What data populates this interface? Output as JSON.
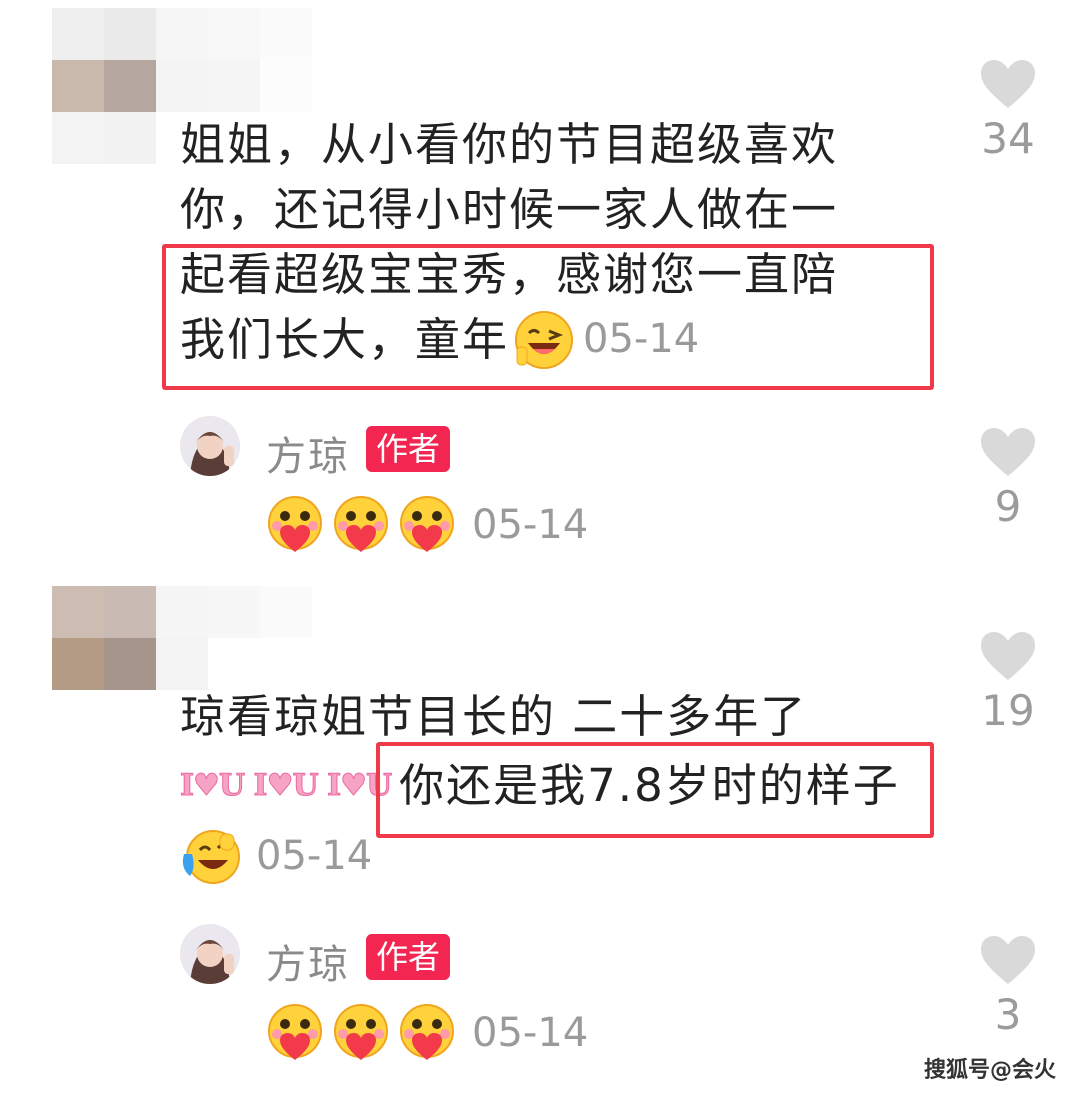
{
  "comments": [
    {
      "lines": [
        "姐姐，从小看你的节目超级喜欢",
        "你，还记得小时候一家人做在一",
        "起看超级宝宝秀，感谢您一直陪",
        "我们长大，童年"
      ],
      "date": "05-14",
      "likes": "34",
      "reply": {
        "name": "方琼",
        "badge": "作者",
        "date": "05-14",
        "likes": "9"
      }
    },
    {
      "line1": "琼看琼姐节目长的 二十多年了",
      "line2_decor": "I♥U I♥U I♥U",
      "line2_text": "你还是我7.8岁时的样子",
      "date": "05-14",
      "likes": "19",
      "reply": {
        "name": "方琼",
        "badge": "作者",
        "date": "05-14",
        "likes": "3"
      }
    }
  ],
  "watermark": "搜狐号@会火",
  "colors": {
    "highlight": "#ee3a4a",
    "badge": "#f22650",
    "muted": "#9a9a9a",
    "heart": "#d9d9d9"
  }
}
